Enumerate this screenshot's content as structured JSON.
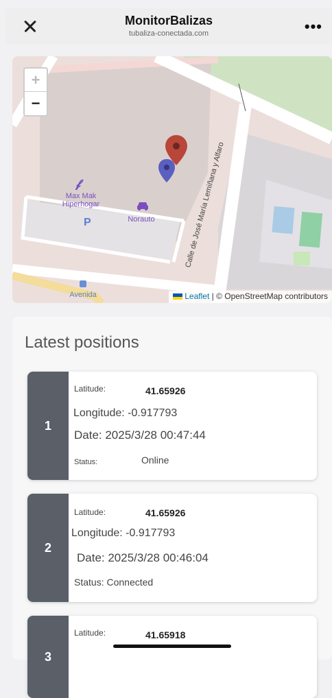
{
  "browser": {
    "title": "MonitorBalizas",
    "url": "tubaliza-conectada.com",
    "close_icon": "close-icon",
    "menu_icon": "more-horizontal-icon",
    "menu_label": "•••"
  },
  "map": {
    "zoom_in": "+",
    "zoom_out": "−",
    "labels": {
      "shop": "Max Mak\nHiperhogar",
      "car_place": "Norauto",
      "parking": "P",
      "street": "Calle de José María Lemiñana y Alfaro",
      "bus_stop": "Avenida"
    },
    "attribution": {
      "leaflet": "Leaflet",
      "rest": "| © OpenStreetMap contributors"
    },
    "markers": [
      "red-marker",
      "blue-marker"
    ]
  },
  "positions": {
    "title": "Latest positions",
    "items": [
      {
        "index": "1",
        "latitude_label": "Latitude:",
        "latitude": "41.65926",
        "longitude": "Longitude: -0.917793",
        "date": "Date: 2025/3/28 00:47:44",
        "status_label": "Status:",
        "status": "Online"
      },
      {
        "index": "2",
        "latitude_label": "Latitude:",
        "latitude": "41.65926",
        "longitude": "Longitude: -0.917793",
        "date": "Date: 2025/3/28 00:46:04",
        "status_full": "Status: Connected"
      },
      {
        "index": "3",
        "latitude_label": "Latitude:",
        "latitude": "41.65918"
      }
    ]
  },
  "colors": {
    "card_index_bg": "#5a5f68",
    "marker_red": "#b8473a",
    "marker_blue": "#5b5fbf",
    "leaflet_link": "#0078a8"
  }
}
